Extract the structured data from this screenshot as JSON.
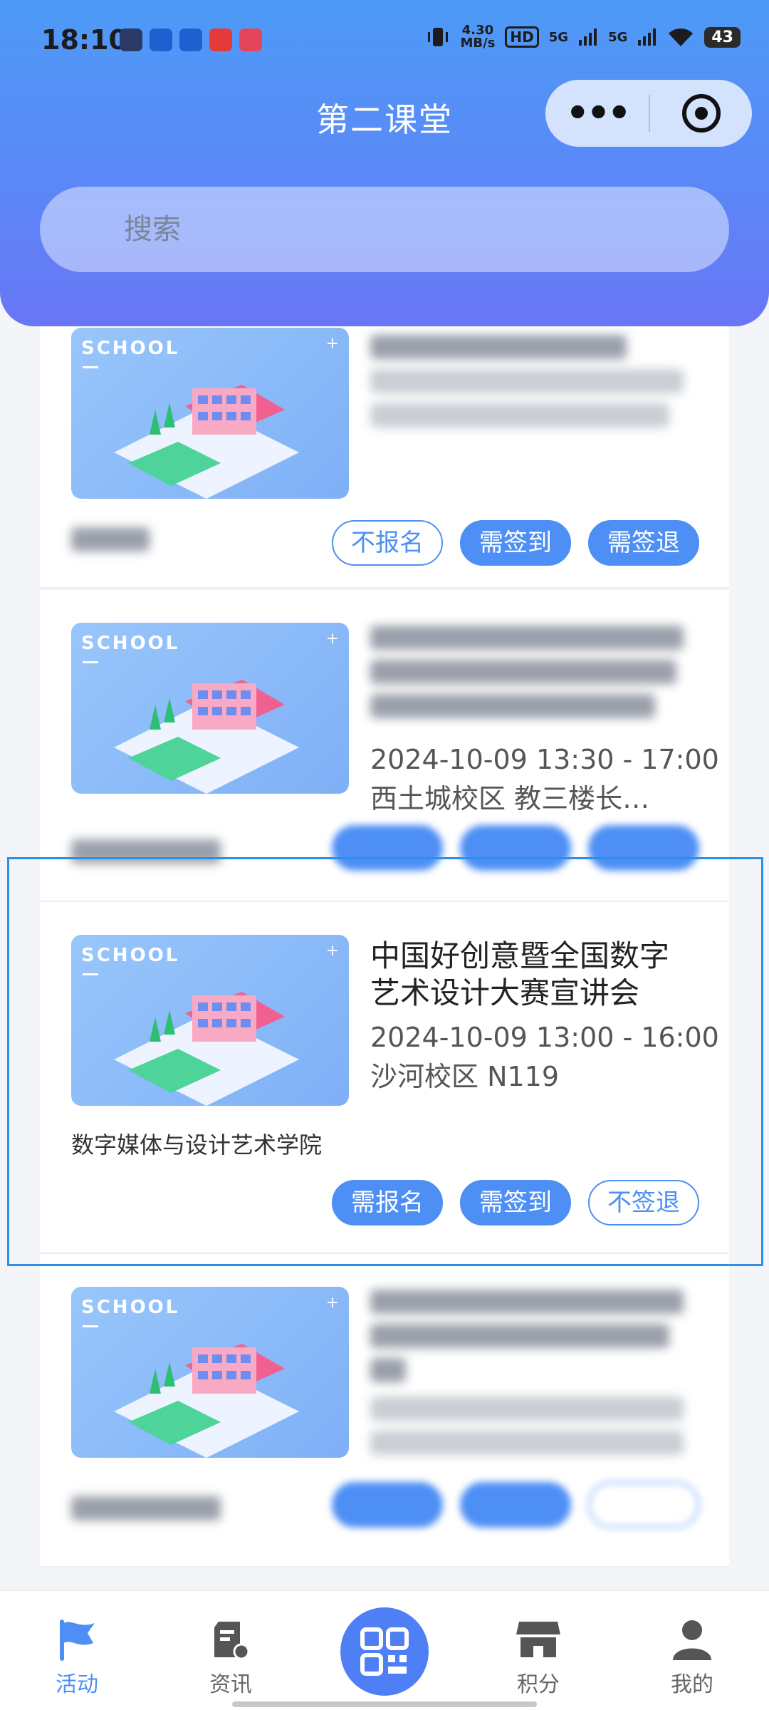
{
  "status_bar": {
    "time": "18:10",
    "net_speed_value": "4.30",
    "net_speed_unit": "MB/s",
    "hd": "HD",
    "signal1": "5G",
    "signal2": "5G",
    "battery": "43"
  },
  "header": {
    "title": "第二课堂",
    "search_placeholder": "搜索"
  },
  "thumb": {
    "label": "SCHOOL",
    "plus": "+"
  },
  "cards": [
    {
      "title": "",
      "time": "",
      "location": "",
      "org": "",
      "buttons": [
        "不报名",
        "需签到",
        "需签退"
      ]
    },
    {
      "title": "",
      "time": "2024-10-09 13:30 - 17:00",
      "location": "西土城校区 教三楼长…",
      "org": "",
      "buttons": [
        "",
        "",
        ""
      ]
    },
    {
      "title": "中国好创意暨全国数字艺术设计大赛宣讲会",
      "time": "2024-10-09 13:00 - 16:00",
      "location": "沙河校区 N119",
      "org": "数字媒体与设计艺术学院",
      "buttons": [
        "需报名",
        "需签到",
        "不签退"
      ]
    },
    {
      "title": "",
      "time": "",
      "location": "",
      "org": "",
      "buttons": [
        "",
        "",
        ""
      ]
    }
  ],
  "tabbar": {
    "items": [
      {
        "label": "活动",
        "icon": "flag-icon"
      },
      {
        "label": "资讯",
        "icon": "news-icon"
      },
      {
        "label": "",
        "icon": "qrcode-icon"
      },
      {
        "label": "积分",
        "icon": "store-icon"
      },
      {
        "label": "我的",
        "icon": "person-icon"
      }
    ]
  },
  "colors": {
    "accent": "#4d8ff5",
    "header_top": "#4e9bf7",
    "header_bottom": "#6976f6"
  }
}
